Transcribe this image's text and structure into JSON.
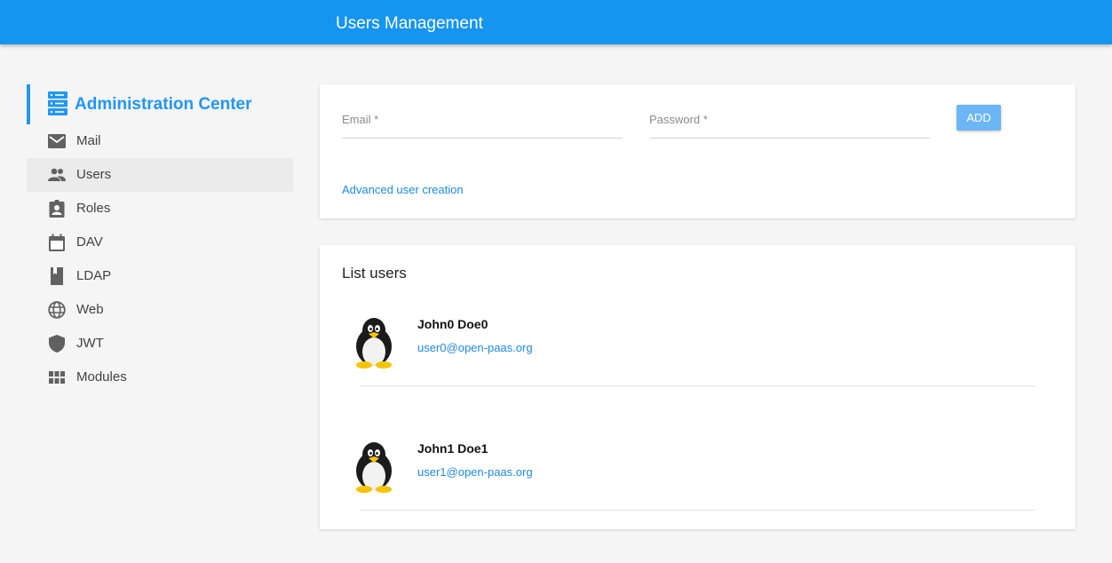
{
  "header": {
    "title": "Users Management",
    "bg_color": "#1594f0"
  },
  "sidebar": {
    "brand": {
      "label": "Administration Center",
      "icon": "server-icon",
      "color": "#2196f3"
    },
    "items": [
      {
        "label": "Mail",
        "icon": "mail-icon"
      },
      {
        "label": "Users",
        "icon": "users-icon",
        "active": true
      },
      {
        "label": "Roles",
        "icon": "badge-icon"
      },
      {
        "label": "DAV",
        "icon": "calendar-icon"
      },
      {
        "label": "LDAP",
        "icon": "book-icon"
      },
      {
        "label": "Web",
        "icon": "globe-icon"
      },
      {
        "label": "JWT",
        "icon": "shield-icon"
      },
      {
        "label": "Modules",
        "icon": "grid-icon"
      }
    ]
  },
  "form": {
    "email_placeholder": "Email *",
    "email_value": "",
    "password_placeholder": "Password *",
    "password_value": "",
    "add_label": "ADD",
    "advanced_link": "Advanced user creation"
  },
  "list": {
    "title": "List users",
    "users": [
      {
        "name": "John0 Doe0",
        "email": "user0@open-paas.org",
        "avatar": "penguin-avatar"
      },
      {
        "name": "John1 Doe1",
        "email": "user1@open-paas.org",
        "avatar": "penguin-avatar"
      }
    ]
  }
}
